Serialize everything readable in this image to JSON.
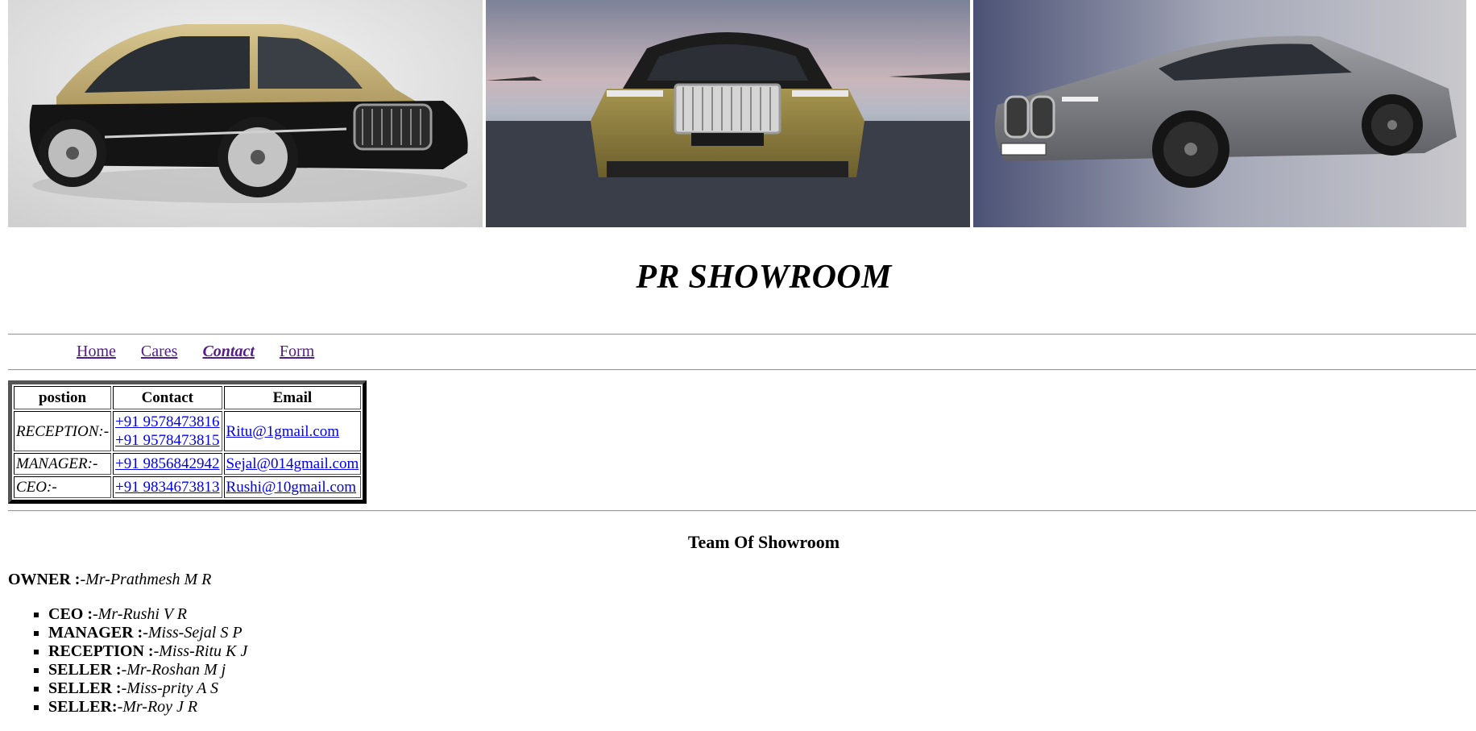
{
  "site": {
    "title": "PR SHOWROOM"
  },
  "car_images": [
    {
      "name": "black-gold-sedan",
      "colors": {
        "body_top": "#c9b37c",
        "body_bottom": "#141414",
        "bg": "#e2e2e2"
      }
    },
    {
      "name": "gold-coupe-front",
      "colors": {
        "body": "#8a7a3a",
        "roof": "#1c1c1c",
        "sky": "#9aa3b4",
        "ground": "#3a3e48"
      }
    },
    {
      "name": "grey-sedan",
      "colors": {
        "body": "#7b7d82",
        "bg": "#9fa3b8"
      }
    }
  ],
  "nav": {
    "items": [
      {
        "label": "Home"
      },
      {
        "label": "Cares"
      },
      {
        "label": "Contact"
      },
      {
        "label": "Form"
      }
    ]
  },
  "contacts_table": {
    "headers": [
      "postion",
      "Contact",
      "Email"
    ],
    "rows": [
      {
        "position": "RECEPTION:-",
        "phones": [
          "+91 9578473816",
          "+91 9578473815"
        ],
        "email": "Ritu@1gmail.com"
      },
      {
        "position": "MANAGER:-",
        "phones": [
          "+91 9856842942"
        ],
        "email": "Sejal@014gmail.com"
      },
      {
        "position": "CEO:-",
        "phones": [
          "+91 9834673813"
        ],
        "email": "Rushi@10gmail.com"
      }
    ]
  },
  "team": {
    "title": "Team Of Showroom",
    "owner": {
      "role": "OWNER :",
      "name": "-Mr-Prathmesh M R"
    },
    "members": [
      {
        "role": "CEO :",
        "name": "-Mr-Rushi V R"
      },
      {
        "role": "MANAGER :",
        "name": "-Miss-Sejal S P"
      },
      {
        "role": "RECEPTION :",
        "name": "-Miss-Ritu K J"
      },
      {
        "role": "SELLER :",
        "name": "-Mr-Roshan M j"
      },
      {
        "role": "SELLER :",
        "name": "-Miss-prity A S"
      },
      {
        "role": "SELLER:",
        "name": "-Mr-Roy J R"
      }
    ]
  }
}
